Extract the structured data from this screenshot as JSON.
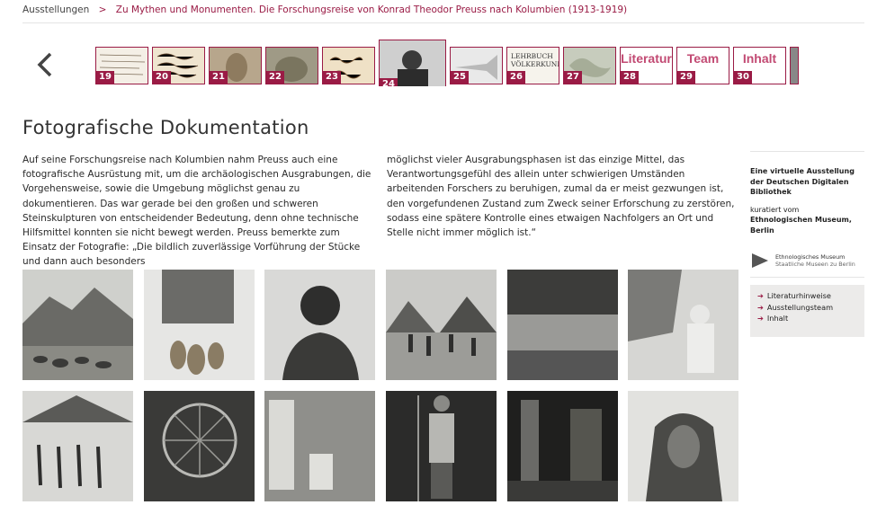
{
  "breadcrumb": {
    "home": "Ausstellungen",
    "separator": ">",
    "current": "Zu Mythen und Monumenten. Die Forschungsreise von Konrad Theodor Preuss nach Kolumbien (1913-1919)"
  },
  "nav": {
    "prev_icon": "chevron-left-icon",
    "thumbs": [
      {
        "num": "19",
        "label": "",
        "alt": "handwritten-notes"
      },
      {
        "num": "20",
        "label": "",
        "alt": "handwritten-document"
      },
      {
        "num": "21",
        "label": "",
        "alt": "figure-photo"
      },
      {
        "num": "22",
        "label": "",
        "alt": "stone-sculpture"
      },
      {
        "num": "23",
        "label": "",
        "alt": "handwritten-book"
      },
      {
        "num": "24",
        "label": "",
        "alt": "portrait-photo",
        "active": true
      },
      {
        "num": "25",
        "label": "",
        "alt": "trumpet-object"
      },
      {
        "num": "26",
        "label": "",
        "book_text_1": "LEHRBUCH",
        "book_text_2": "VÖLKERKUNI",
        "alt": "textbook"
      },
      {
        "num": "27",
        "label": "",
        "alt": "map"
      },
      {
        "num": "28",
        "label": "Literatur"
      },
      {
        "num": "29",
        "label": "Team"
      },
      {
        "num": "30",
        "label": "Inhalt"
      }
    ]
  },
  "main": {
    "title": "Fotografische Dokumentation",
    "paragraph_col1": "Auf seine Forschungsreise nach Kolumbien nahm Preuss auch eine fotografische Ausrüstung mit, um die archäologischen Ausgrabungen, die Vorgehensweise, sowie die Umgebung möglichst genau zu dokumentieren. Das war gerade bei den großen und schweren Steinskulpturen von entscheidender Bedeutung, denn ohne technische Hilfsmittel konnten sie nicht bewegt werden. Preuss bemerkte zum Einsatz der Fotografie: „Die bildlich zuverlässige Vorführung der Stücke und dann auch besonders",
    "paragraph_col2": "möglichst vieler Ausgrabungsphasen ist das einzige Mittel, das Verantwortungsgefühl des allein unter schwierigen Umständen arbeitenden Forschers zu beruhigen, zumal da er meist gezwungen ist, den vorgefundenen Zustand zum Zweck seiner Erforschung zu zerstören, sodass eine spätere Kontrolle eines etwaigen Nachfolgers an Ort und Stelle nicht immer möglich ist.“"
  },
  "photos": [
    "landscape-with-stones",
    "hanging-gourds",
    "portrait-man",
    "village-huts",
    "river-landscape",
    "man-with-object",
    "dancers-under-roof",
    "wheel-structure",
    "women-at-hut",
    "man-with-spear",
    "dark-interior",
    "masked-figure"
  ],
  "sidebar": {
    "intro": "Eine virtuelle Ausstellung der Deutschen Digitalen Bibliothek",
    "curated_by": "kuratiert vom",
    "museum": "Ethnologischen Museum, Berlin",
    "logo_line1": "Ethnologisches Museum",
    "logo_line2": "Staatliche Museen zu Berlin",
    "links": [
      "Literaturhinweise",
      "Ausstellungsteam",
      "Inhalt"
    ]
  },
  "colors": {
    "accent": "#9a1b45"
  }
}
